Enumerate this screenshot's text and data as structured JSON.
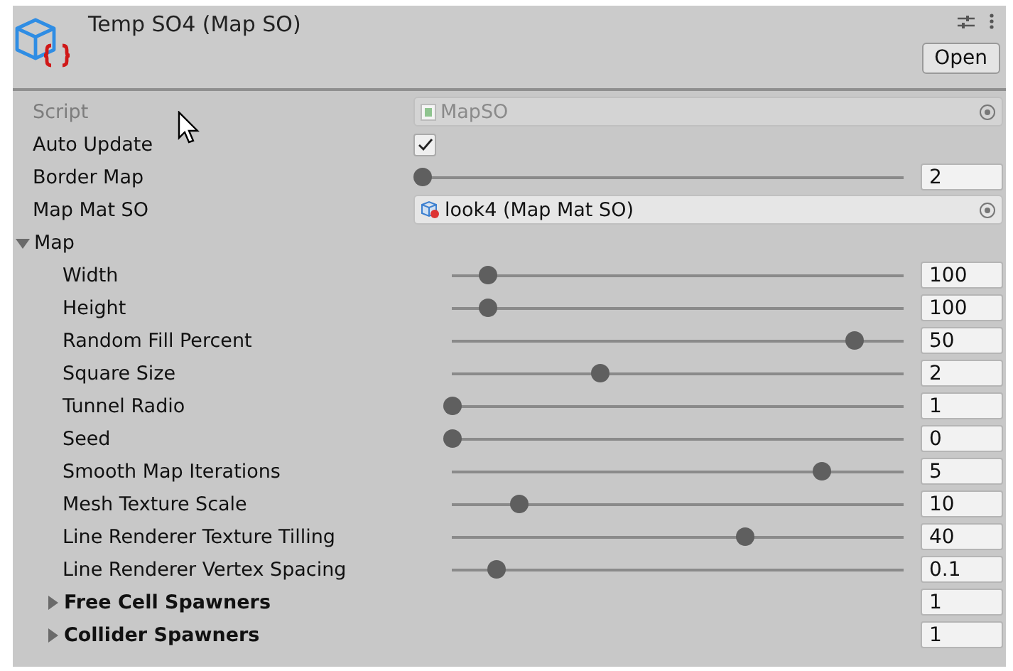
{
  "header": {
    "title": "Temp SO4 (Map SO)",
    "open_button": "Open"
  },
  "fields": [
    {
      "kind": "object",
      "label": "Script",
      "value": "MapSO",
      "disabled": true
    },
    {
      "kind": "checkbox",
      "label": "Auto Update",
      "checked": true,
      "disabled": false
    },
    {
      "kind": "slider",
      "label": "Border Map",
      "level": 0,
      "value": "2",
      "disabled": false
    },
    {
      "kind": "object",
      "label": "Map Mat SO",
      "value": "look4 (Map Mat SO)",
      "disabled": false
    },
    {
      "kind": "foldout",
      "label": "Map",
      "expanded": true,
      "disabled": false,
      "children": [
        {
          "kind": "slider",
          "label": "Width",
          "level": 0.08,
          "value": "100"
        },
        {
          "kind": "slider",
          "label": "Height",
          "level": 0.08,
          "value": "100"
        },
        {
          "kind": "slider",
          "label": "Random Fill Percent",
          "level": 0.89,
          "value": "50"
        },
        {
          "kind": "slider",
          "label": "Square Size",
          "level": 0.33,
          "value": "2"
        },
        {
          "kind": "slider",
          "label": "Tunnel Radio",
          "level": 0,
          "value": "1"
        },
        {
          "kind": "slider",
          "label": "Seed",
          "level": 0,
          "value": "0"
        },
        {
          "kind": "slider",
          "label": "Smooth Map Iterations",
          "level": 0.82,
          "value": "5"
        },
        {
          "kind": "slider",
          "label": "Mesh Texture Scale",
          "level": 0.15,
          "value": "10"
        },
        {
          "kind": "slider",
          "label": "Line Renderer Texture Tilling",
          "level": 0.65,
          "value": "40"
        },
        {
          "kind": "slider",
          "label": "Line Renderer Vertex Spacing",
          "level": 0.1,
          "value": "0.1"
        },
        {
          "kind": "foldout",
          "label": "Free Cell Spawners",
          "expanded": false,
          "value": "1"
        },
        {
          "kind": "foldout",
          "label": "Collider Spawners",
          "expanded": false,
          "value": "1"
        }
      ]
    }
  ]
}
